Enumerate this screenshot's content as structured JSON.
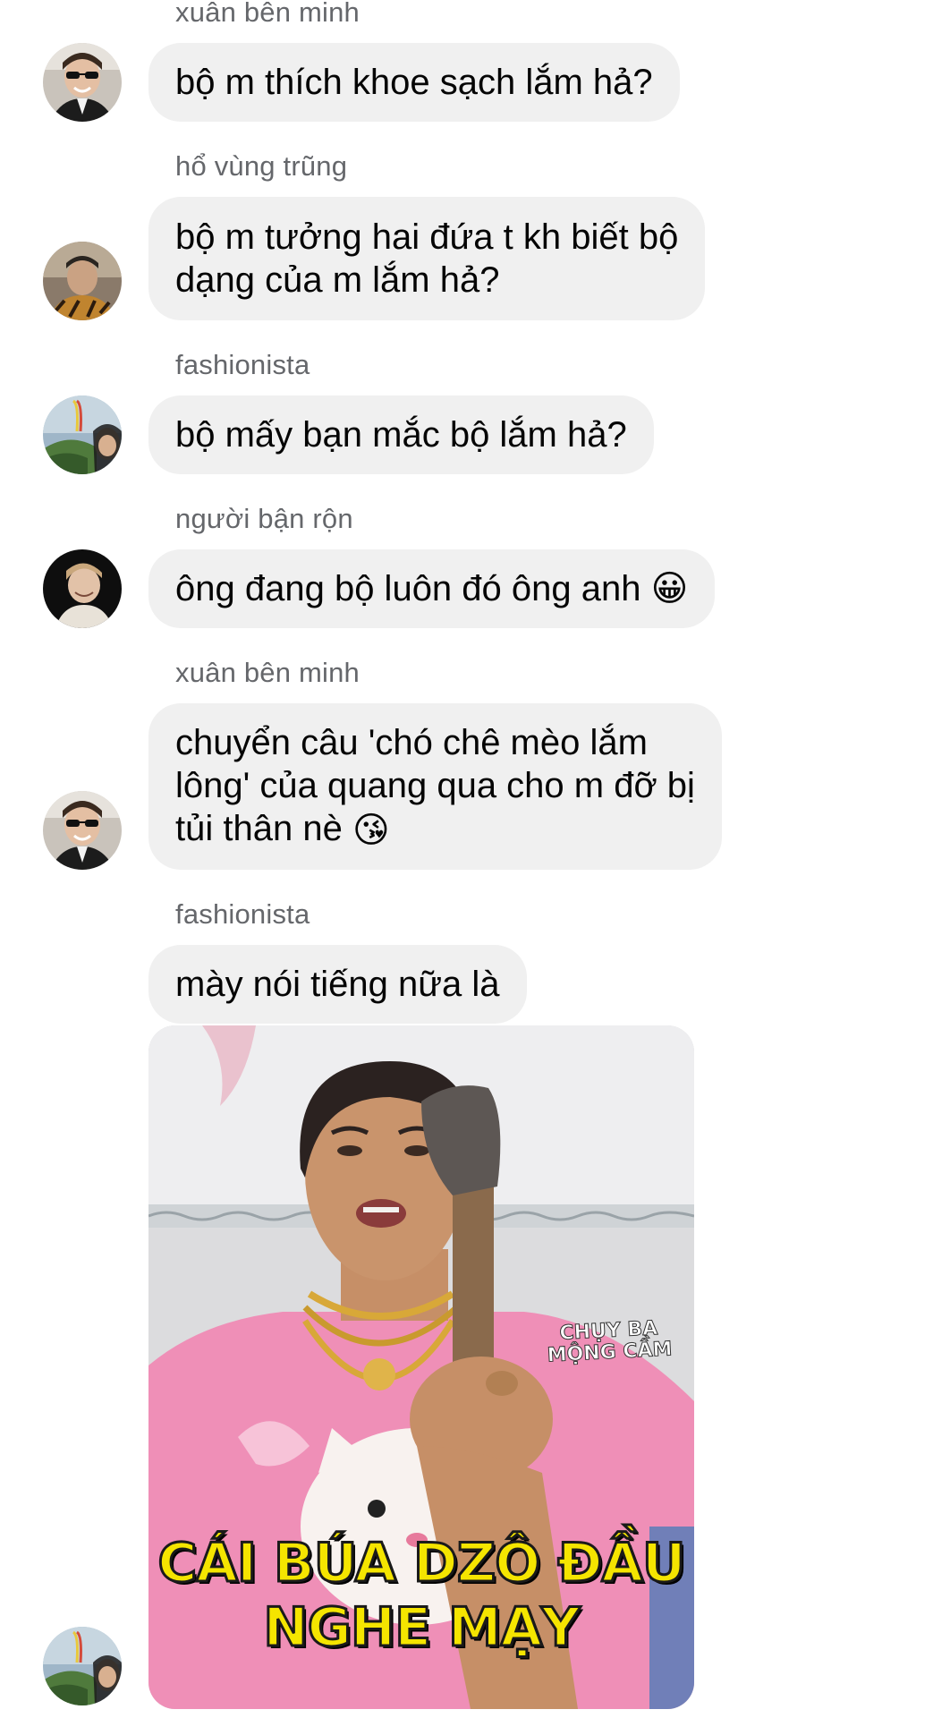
{
  "messages": [
    {
      "sender": "xuân bên minh",
      "text": "bộ m thích khoe sạch lắm hả?"
    },
    {
      "sender": "hổ vùng trũng",
      "text": "bộ m tưởng hai đứa t kh biết bộ\ndạng của m lắm hả?"
    },
    {
      "sender": "fashionista",
      "text": "bộ mấy bạn mắc bộ lắm hả?"
    },
    {
      "sender": "người bận rộn",
      "text": "ông đang bộ luôn đó ông anh",
      "emoji": "😀"
    },
    {
      "sender": "xuân bên minh",
      "text": "chuyển câu 'chó chê mèo lắm\nlông' của quang qua cho m đỡ bị\ntủi thân nè",
      "emoji": "😘"
    },
    {
      "sender": "fashionista",
      "text": "mày nói tiếng nữa là"
    }
  ],
  "meme": {
    "watermark_line1": "CHỤY BA",
    "watermark_line2": "MỘNG CẦM",
    "caption_line1": "CÁI BÚA DZÔ ĐẦU",
    "caption_line2": "NGHE MẠY"
  },
  "colors": {
    "bubble": "#f0f0f0",
    "sender_name": "#65676b",
    "text": "#050505",
    "caption": "#f5e500"
  }
}
